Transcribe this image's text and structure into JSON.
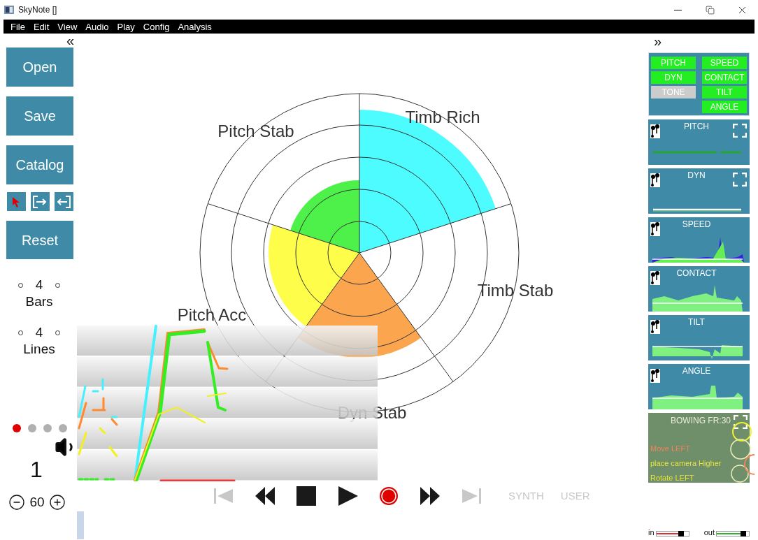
{
  "window": {
    "title": "SkyNote []"
  },
  "menu": [
    "File",
    "Edit",
    "View",
    "Audio",
    "Play",
    "Config",
    "Analysis"
  ],
  "left_panel": {
    "collapse": "«",
    "buttons": [
      "Open",
      "Save",
      "Catalog"
    ],
    "tools": [
      {
        "kind": "pointer"
      },
      {
        "kind": "export"
      },
      {
        "kind": "import"
      }
    ],
    "reset": "Reset",
    "steppers": [
      {
        "value": "4",
        "label": "Bars"
      },
      {
        "value": "4",
        "label": "Lines"
      }
    ],
    "pages": [
      {
        "selected": true
      },
      {
        "selected": false
      },
      {
        "selected": false
      },
      {
        "selected": false
      }
    ],
    "count": "1",
    "tempo": "60"
  },
  "radar": {
    "axes": [
      "Timb Rich",
      "Timb Stab",
      "Dyn Stab",
      "Pitch Acc",
      "Pitch Stab"
    ]
  },
  "transport": {
    "buttons": [
      {
        "kind": "skip-back",
        "disabled": true
      },
      {
        "kind": "rewind",
        "disabled": false
      },
      {
        "kind": "stop",
        "disabled": false
      },
      {
        "kind": "play",
        "disabled": false
      },
      {
        "kind": "record",
        "disabled": false
      },
      {
        "kind": "fast-forward",
        "disabled": false
      },
      {
        "kind": "skip-end",
        "disabled": true
      }
    ],
    "modes": [
      {
        "label": "SYNTH",
        "on": false
      },
      {
        "label": "USER",
        "on": false
      }
    ]
  },
  "right_panel": {
    "expand": "»",
    "toggles": {
      "left": [
        {
          "label": "PITCH",
          "on": true
        },
        {
          "label": "DYN",
          "on": true
        },
        {
          "label": "TONE",
          "on": false
        }
      ],
      "right": [
        {
          "label": "SPEED",
          "on": true
        },
        {
          "label": "CONTACT",
          "on": true
        },
        {
          "label": "TILT",
          "on": true
        },
        {
          "label": "ANGLE",
          "on": true
        }
      ]
    },
    "monitors": [
      {
        "label": "PITCH",
        "kind": "line",
        "expandable": true
      },
      {
        "label": "DYN",
        "kind": "flat",
        "expandable": true
      },
      {
        "label": "SPEED",
        "kind": "speed",
        "expandable": false
      },
      {
        "label": "CONTACT",
        "kind": "contact",
        "expandable": false
      },
      {
        "label": "TILT",
        "kind": "tilt",
        "expandable": false
      },
      {
        "label": "ANGLE",
        "kind": "angle",
        "expandable": false
      }
    ],
    "bowing": {
      "title": "BOWING FR:30",
      "messages": [
        {
          "text": "Move LEFT",
          "color": "#f0845c"
        },
        {
          "text": "place camera Higher",
          "color": "#e8e43c"
        },
        {
          "text": "Rotate LEFT",
          "color": "#e8e43c"
        }
      ]
    },
    "meters": [
      {
        "label": "in",
        "level": 0.78,
        "color": "#e03030"
      },
      {
        "label": "out",
        "level": 0.82,
        "color": "#30b030"
      }
    ]
  }
}
